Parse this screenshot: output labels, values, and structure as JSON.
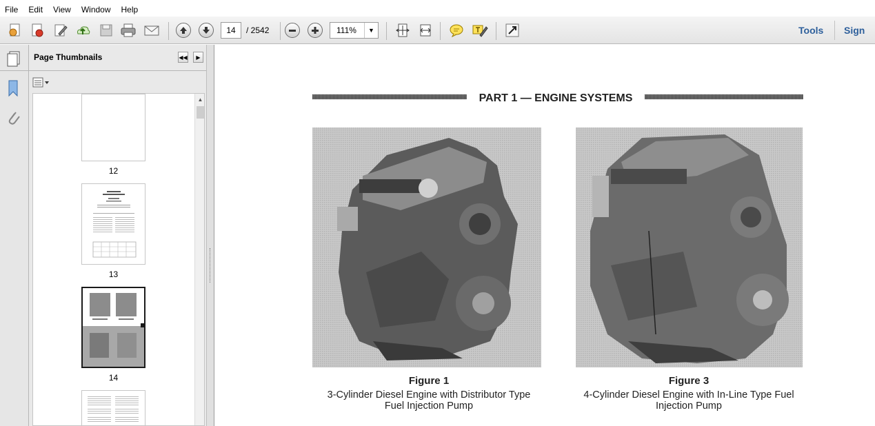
{
  "menubar": {
    "items": [
      "File",
      "Edit",
      "View",
      "Window",
      "Help"
    ]
  },
  "toolbar": {
    "page_number": "14",
    "page_total": "/ 2542",
    "zoom": "111%",
    "tools_label": "Tools",
    "sign_label": "Sign",
    "icons": [
      "create-icon",
      "convert-icon",
      "edit-icon",
      "upload-icon",
      "save-icon",
      "print-icon",
      "email-icon",
      "prev-page-icon",
      "next-page-icon",
      "zoom-out-icon",
      "zoom-in-icon",
      "fit-page-icon",
      "fit-width-icon",
      "comment-icon",
      "highlight-icon",
      "fullscreen-icon"
    ]
  },
  "panel": {
    "title": "Page Thumbnails",
    "thumbnails": [
      {
        "label": "12"
      },
      {
        "label": "13"
      },
      {
        "label": "14"
      },
      {
        "label": ""
      }
    ]
  },
  "document": {
    "heading": "PART 1 — ENGINE SYSTEMS",
    "figures": [
      {
        "title": "Figure 1",
        "caption_line1": "3-Cylinder Diesel Engine with Distributor Type",
        "caption_line2": "Fuel Injection Pump"
      },
      {
        "title": "Figure 3",
        "caption_line1": "4-Cylinder Diesel Engine with In-Line Type Fuel",
        "caption_line2": "Injection Pump"
      }
    ]
  },
  "colors": {
    "link": "#2d5f9b",
    "toolbar_bg": "#e9e9e9",
    "panel_bg": "#e9e9e9"
  }
}
